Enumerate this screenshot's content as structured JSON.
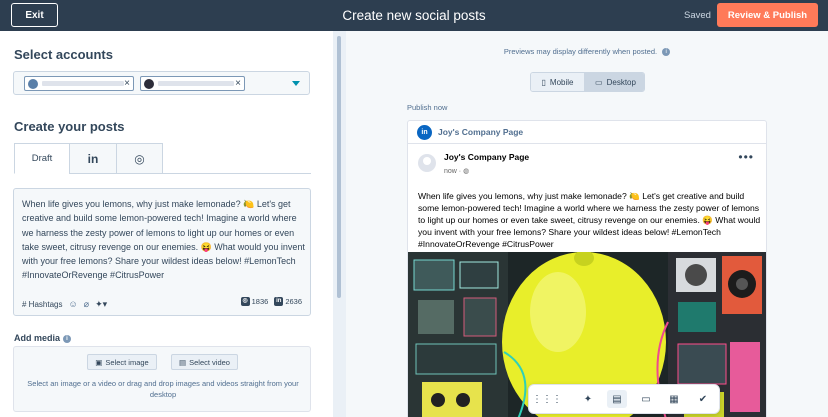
{
  "topbar": {
    "exit_label": "Exit",
    "title": "Create new social posts",
    "saved_label": "Saved",
    "publish_label": "Review & Publish"
  },
  "left": {
    "select_accounts_title": "Select accounts",
    "accounts": [
      {
        "icon": "linkedin-account-avatar",
        "remove": "×"
      },
      {
        "icon": "instagram-account-avatar",
        "remove": "×"
      }
    ],
    "create_posts_title": "Create your posts",
    "tabs": [
      {
        "label": "Draft",
        "icon": "draft-tab"
      },
      {
        "label": "in",
        "icon": "linkedin-icon"
      },
      {
        "label": "◎",
        "icon": "instagram-icon"
      }
    ],
    "post_body": "When life gives you lemons, why just make lemonade? 🍋 Let's get creative and build some lemon-powered tech! Imagine a world where we harness the zesty power of lemons to light up our homes or even take sweet, citrusy revenge on our enemies. 😝 What would you invent with your free lemons? Share your wildest ideas below! #LemonTech #InnovateOrRevenge #CitrusPower",
    "hashtags_label": "# Hashtags",
    "instagram_count": "1836",
    "linkedin_count": "2636",
    "add_media_label": "Add media",
    "select_image_label": "Select image",
    "select_video_label": "Select video",
    "media_hint": "Select an image or a video or drag and drop images and videos straight from your desktop"
  },
  "right": {
    "preview_note": "Previews may display differently when posted.",
    "mobile_label": "Mobile",
    "desktop_label": "Desktop",
    "publish_now": "Publish now",
    "page_name": "Joy's Company Page",
    "post_author": "Joy's Company Page",
    "post_time": "now ·",
    "post_text": "When life gives you lemons, why just make lemonade? 🍋 Let's get creative and build some lemon-powered tech! Imagine a world where we harness the zesty power of lemons to light up our homes or even take sweet, citrusy revenge on our enemies. 😝 What would you invent with your free lemons? Share your wildest ideas below! #LemonTech #InnovateOrRevenge #CitrusPower"
  },
  "colors": {
    "topbar": "#2d3e50",
    "accent": "#ff7a59",
    "link": "#0091ae",
    "linkedin": "#0a66c2"
  }
}
